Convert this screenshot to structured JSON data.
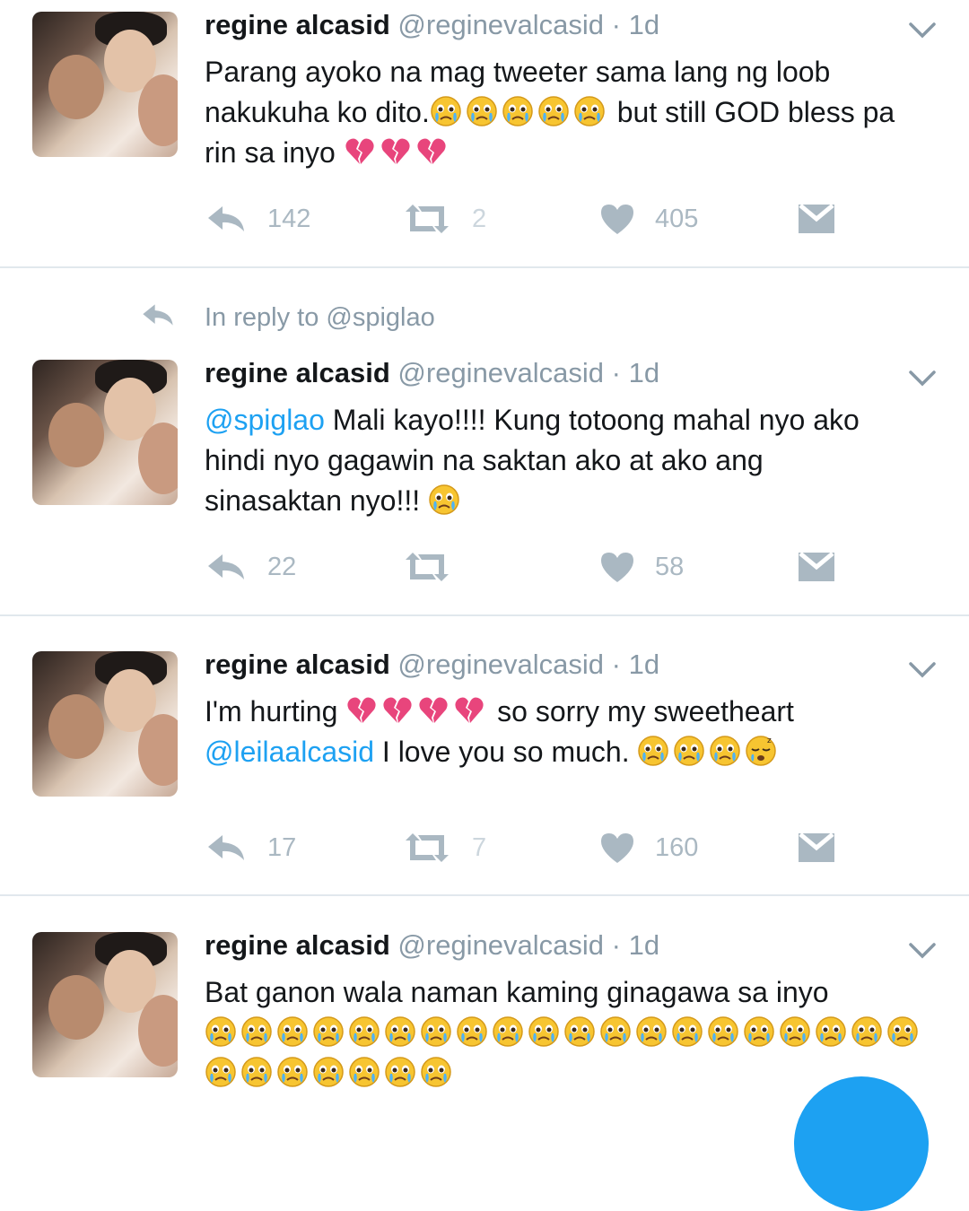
{
  "colors": {
    "accent": "#1da1f2",
    "muted": "#8899a6",
    "action": "#aab8c2",
    "separator": "#e1e8ed"
  },
  "tweets": [
    {
      "name": "regine alcasid",
      "handle": "@reginevalcasid",
      "time": "· 1d",
      "line1": "Parang ayoko na mag tweeter sama lang ng loob",
      "line2a": "nakukuha ko dito.",
      "line2b": "but still GOD bless pa",
      "line3": "rin sa inyo",
      "reply_count": "142",
      "retweet_count": "2",
      "like_count": "405",
      "icons": [
        "crying-emoji",
        "broken-heart-emoji"
      ]
    },
    {
      "reply_context": "In reply to @spiglao",
      "name": "regine alcasid",
      "handle": "@reginevalcasid",
      "time": "· 1d",
      "mention": "@spiglao",
      "line1": " Mali kayo!!!! Kung totoong mahal nyo ako",
      "line2": "hindi nyo gagawin na saktan ako at ako ang",
      "line3": "sinasaktan nyo!!!",
      "reply_count": "22",
      "like_count": "58"
    },
    {
      "name": "regine alcasid",
      "handle": "@reginevalcasid",
      "time": "· 1d",
      "line1a": "I'm hurting",
      "line1b": "so sorry my sweetheart",
      "mention": "@leilaalcasid",
      "line2": " I love you so much.",
      "reply_count": "17",
      "retweet_count": "7",
      "like_count": "160",
      "icons": [
        "broken-heart-emoji",
        "crying-emoji",
        "sleepy-emoji"
      ]
    },
    {
      "name": "regine alcasid",
      "handle": "@reginevalcasid",
      "time": "· 1d",
      "line1": "Bat ganon wala naman kaming ginagawa sa inyo"
    }
  ]
}
